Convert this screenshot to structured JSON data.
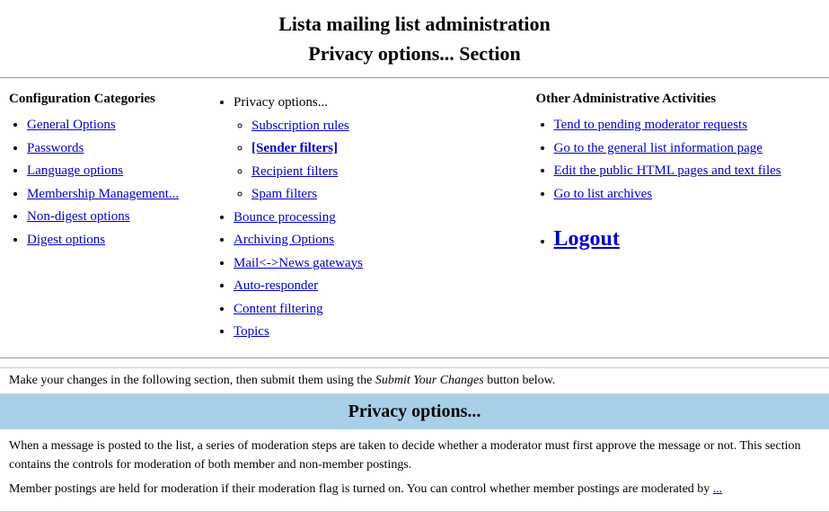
{
  "page": {
    "title_line1": "Lista mailing list administration",
    "title_line2": "Privacy options... Section"
  },
  "config_section": {
    "heading": "Configuration Categories",
    "left_items": [
      {
        "label": "General Options",
        "href": "#"
      },
      {
        "label": "Passwords",
        "href": "#"
      },
      {
        "label": "Language options",
        "href": "#"
      },
      {
        "label": "Membership Management...",
        "href": "#"
      },
      {
        "label": "Non-digest options",
        "href": "#"
      },
      {
        "label": "Digest options",
        "href": "#"
      }
    ],
    "middle_heading": "Privacy options...",
    "middle_sub": [
      {
        "label": "Subscription rules",
        "href": "#"
      },
      {
        "label": "[Sender filters]",
        "href": "#",
        "active": true
      },
      {
        "label": "Recipient filters",
        "href": "#"
      },
      {
        "label": "Spam filters",
        "href": "#"
      }
    ],
    "middle_items": [
      {
        "label": "Bounce processing",
        "href": "#"
      },
      {
        "label": "Archiving Options",
        "href": "#"
      },
      {
        "label": "Mail<->News gateways",
        "href": "#"
      },
      {
        "label": "Auto-responder",
        "href": "#"
      },
      {
        "label": "Content filtering",
        "href": "#"
      },
      {
        "label": "Topics",
        "href": "#"
      }
    ]
  },
  "other_section": {
    "heading": "Other Administrative Activities",
    "items": [
      {
        "label": "Tend to pending moderator requests",
        "href": "#"
      },
      {
        "label": "Go to the general list information page",
        "href": "#"
      },
      {
        "label": "Edit the public HTML pages and text files",
        "href": "#"
      },
      {
        "label": "Go to list archives",
        "href": "#"
      }
    ],
    "logout_label": "Logout",
    "logout_href": "#"
  },
  "instruction": {
    "text_before": "Make your changes in the following section, then submit them using the ",
    "italic_text": "Submit Your Changes",
    "text_after": " button below."
  },
  "privacy_section": {
    "heading": "Privacy options...",
    "description1": "When a message is posted to the list, a series of moderation steps are taken to decide whether a moderator must first approve the message or not. This section contains the controls for moderation of both member and non-member postings.",
    "description2": "Member postings are held for moderation if their moderation flag is turned on. You can control whether member postings are moderated by"
  }
}
